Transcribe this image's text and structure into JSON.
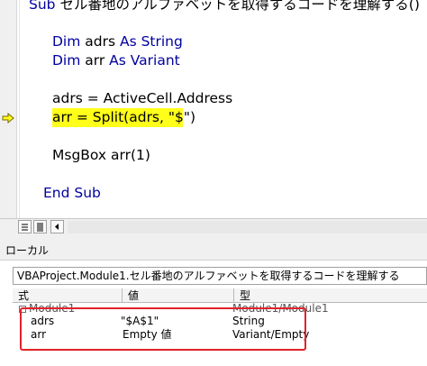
{
  "code": {
    "sub_keyword": "Sub",
    "sub_signature": " セル番地のアルファベットを取得するコードを理解する()",
    "dim1_keyword": "Dim",
    "dim1_var": " adrs ",
    "dim1_as": "As String",
    "dim2_keyword": "Dim",
    "dim2_var": " arr ",
    "dim2_as": "As Variant",
    "line_adrs": "adrs = ActiveCell.Address",
    "line_split": "arr = Split(adrs, \"$\")",
    "line_msgbox": "MsgBox arr(1)",
    "end_sub": "End Sub"
  },
  "locals": {
    "title": "ローカル",
    "context_path": "VBAProject.Module1.セル番地のアルファベットを取得するコードを理解する",
    "headers": {
      "expr": "式",
      "value": "値",
      "type": "型"
    },
    "rows": [
      {
        "expr": "Module1",
        "value": "",
        "type": "Module1/Module1"
      },
      {
        "expr": "adrs",
        "value": "\"$A$1\"",
        "type": "String"
      },
      {
        "expr": "arr",
        "value": "Empty 値",
        "type": "Variant/Empty"
      }
    ]
  },
  "colors": {
    "keyword": "#0000a0",
    "highlight": "#ffff1a",
    "annotation": "#e0222a"
  },
  "icons": {
    "execution_arrow": "arrow-right-icon"
  }
}
